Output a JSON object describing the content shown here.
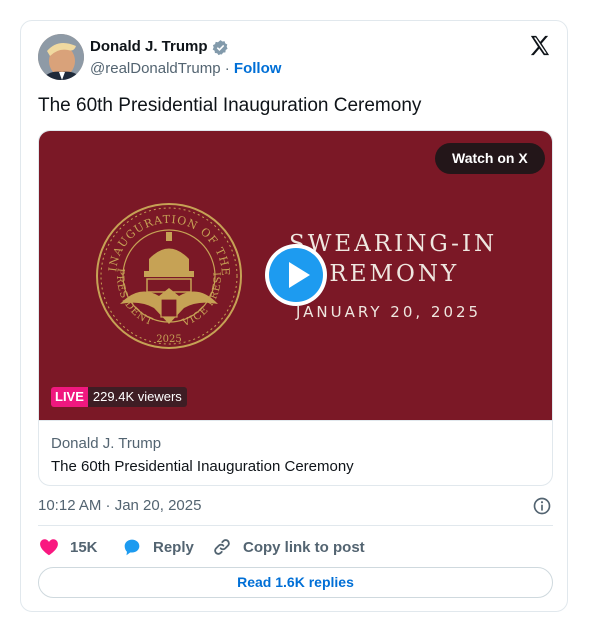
{
  "author": {
    "name": "Donald J. Trump",
    "handle": "@realDonaldTrump",
    "separator": "·",
    "follow_label": "Follow",
    "verified_icon": "verified-badge-icon"
  },
  "platform_icon": "x-logo-icon",
  "tweet": {
    "text": "The 60th Presidential Inauguration Ceremony"
  },
  "media": {
    "watch_label": "Watch on X",
    "graphic": {
      "line1": "SWEARING-IN",
      "line2": "CEREMONY",
      "line3": "JANUARY 20, 2025",
      "seal_top_text": "INAUGURATION OF THE",
      "seal_left_text": "PRESIDENT AND",
      "seal_right_text": "VICE PRESIDENT",
      "seal_year": "2025"
    },
    "live_badge": "LIVE",
    "viewers": "229.4K viewers",
    "card_author": "Donald J. Trump",
    "card_title": "The 60th Presidential Inauguration Ceremony",
    "background_color": "#7b1826"
  },
  "meta": {
    "timestamp": "10:12 AM · Jan 20, 2025"
  },
  "actions": {
    "like_count": "15K",
    "reply_label": "Reply",
    "copy_label": "Copy link to post",
    "read_replies_label": "Read 1.6K replies"
  },
  "colors": {
    "link_blue": "#006fd6",
    "like_pink": "#f91880",
    "reply_blue": "#1d9bf0",
    "gold": "#c6a255"
  }
}
